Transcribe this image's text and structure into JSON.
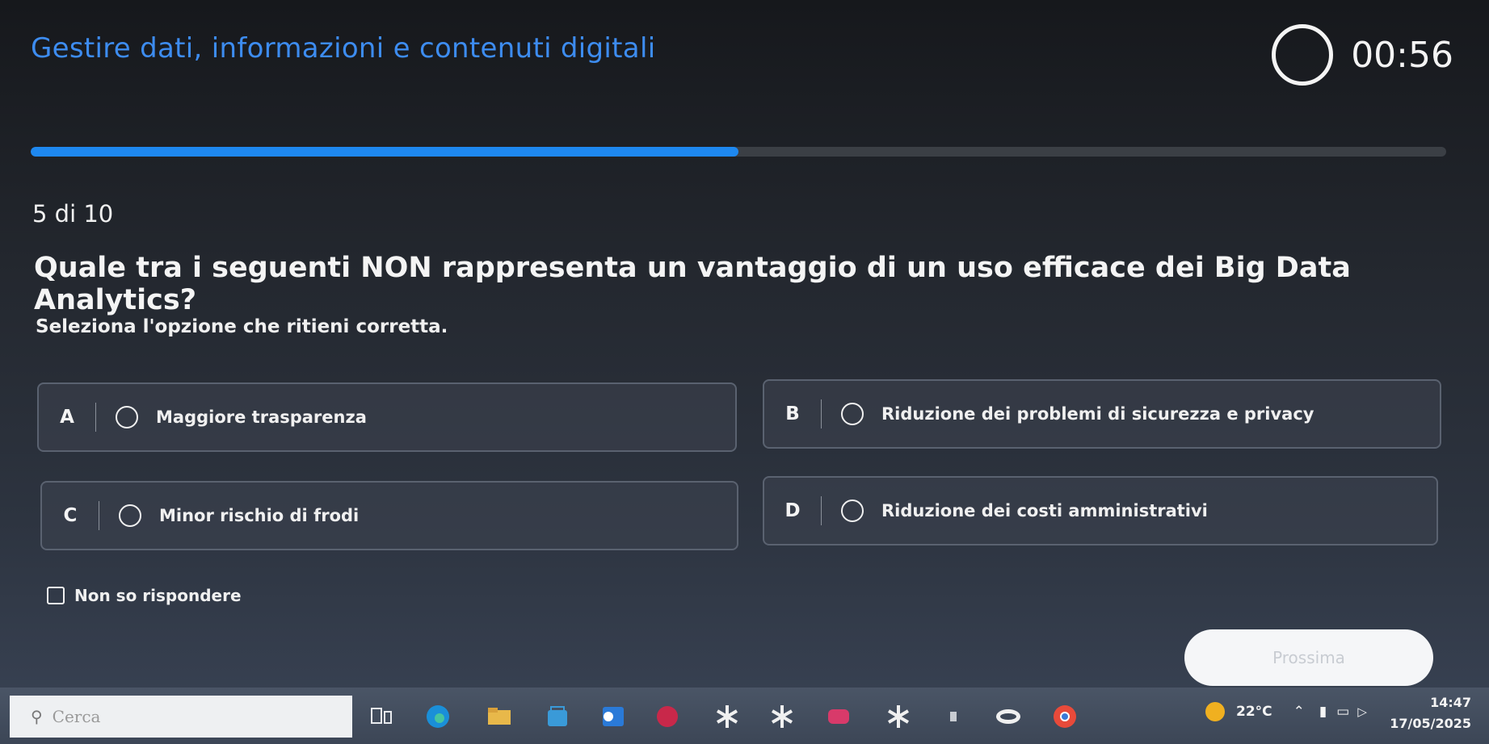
{
  "header": {
    "title": "Gestire dati, informazioni e contenuti digitali"
  },
  "timer": {
    "display": "00:56"
  },
  "progress": {
    "fraction": 0.5,
    "color": "#1e88f0"
  },
  "question": {
    "counter": "5 di 10",
    "text": "Quale tra i seguenti NON rappresenta un vantaggio di un uso efficace dei Big Data Analytics?",
    "instruction": "Seleziona l'opzione che ritieni corretta."
  },
  "options": [
    {
      "letter": "A",
      "label": "Maggiore trasparenza"
    },
    {
      "letter": "B",
      "label": "Riduzione dei problemi di sicurezza e privacy"
    },
    {
      "letter": "C",
      "label": "Minor rischio di frodi"
    },
    {
      "letter": "D",
      "label": "Riduzione dei costi amministrativi"
    }
  ],
  "no_answer": {
    "label": "Non so rispondere"
  },
  "next_button": {
    "label": "Prossima"
  },
  "taskbar": {
    "search_placeholder": "Cerca",
    "temperature": "22°C",
    "time": "14:47",
    "date": "17/05/2025"
  },
  "colors": {
    "accent": "#3d8cf0",
    "background": "#23272e"
  }
}
